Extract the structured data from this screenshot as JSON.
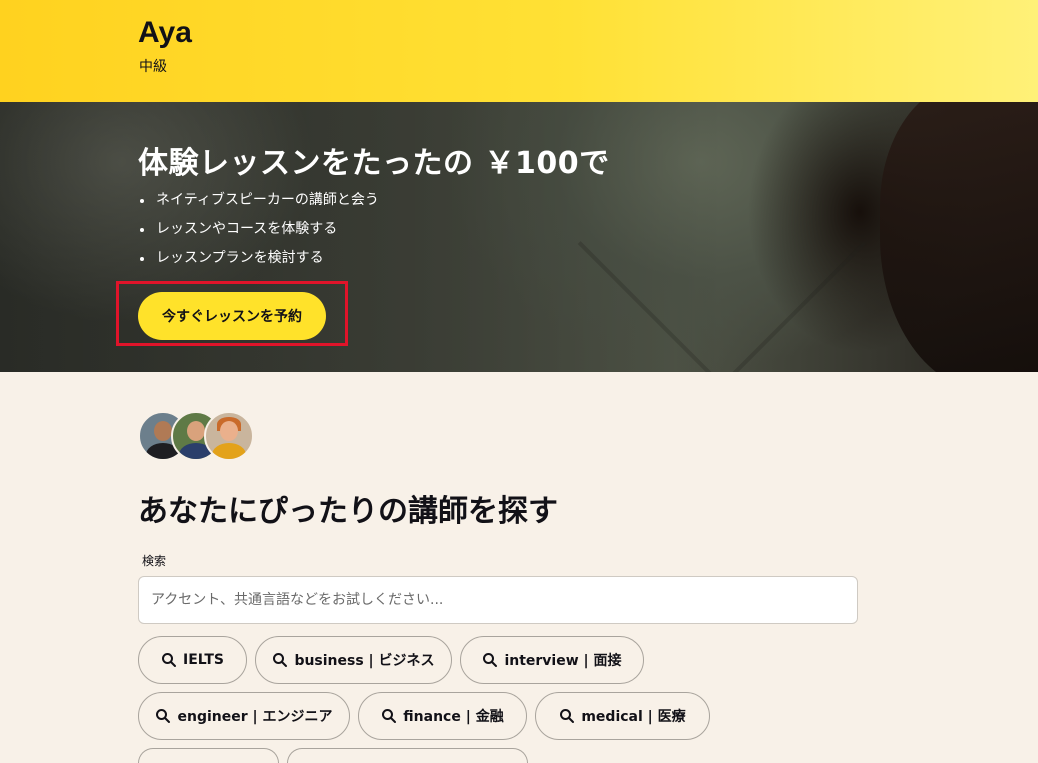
{
  "header": {
    "tutor_name": "Aya",
    "level": "中級"
  },
  "hero": {
    "title": "体験レッスンをたったの ￥100で",
    "bullets": [
      "ネイティブスピーカーの講師と会う",
      "レッスンやコースを体験する",
      "レッスンプランを検討する"
    ],
    "cta_label": "今すぐレッスンを予約"
  },
  "find_tutor": {
    "title": "あなたにぴったりの講師を探す",
    "search_label": "検索",
    "search_placeholder": "アクセント、共通言語などをお試しください..."
  },
  "chips": [
    {
      "label": "IELTS",
      "icon": "search-icon"
    },
    {
      "label": "business | ビジネス",
      "icon": "search-icon"
    },
    {
      "label": "interview | 面接",
      "icon": "search-icon"
    },
    {
      "label": "engineer | エンジニア",
      "icon": "search-icon"
    },
    {
      "label": "finance | 金融",
      "icon": "search-icon"
    },
    {
      "label": "medical | 医療",
      "icon": "search-icon"
    }
  ],
  "colors": {
    "brand_yellow": "#ffe22a",
    "highlight_red": "#e0142a",
    "page_background": "#f8f1e8"
  }
}
